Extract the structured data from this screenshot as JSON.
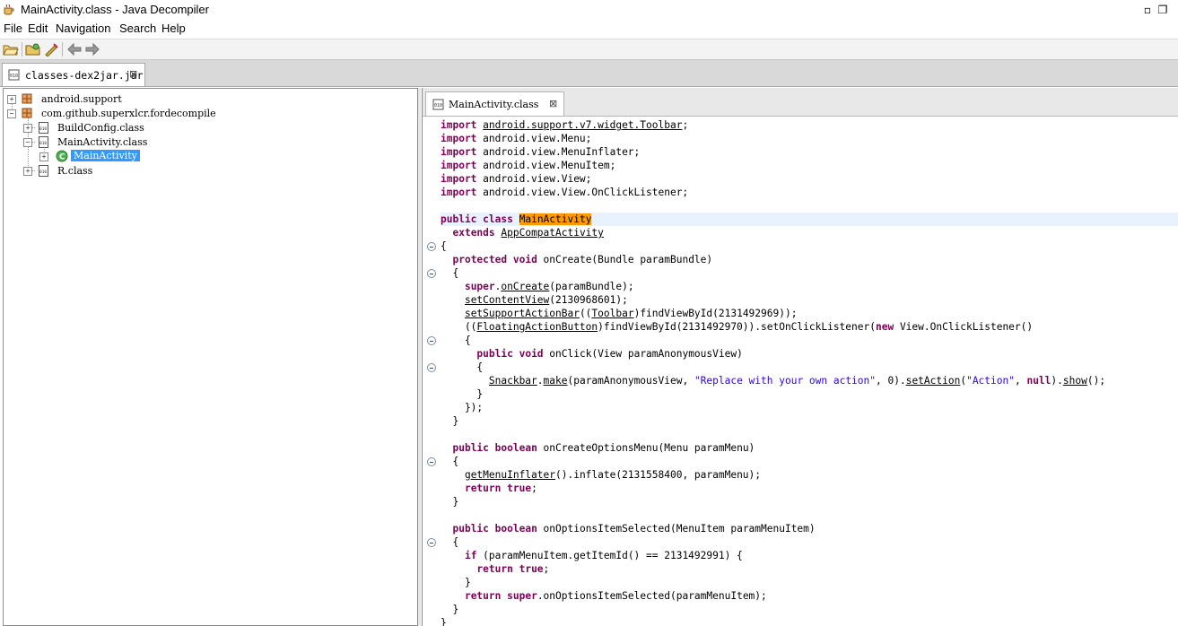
{
  "window": {
    "title": "MainActivity.class - Java Decompiler",
    "maximize_glyph": "▫",
    "restore_glyph": "❐"
  },
  "menu": [
    "File",
    "Edit",
    "Navigation",
    "Search",
    "Help"
  ],
  "toolbar": {
    "icons": [
      "open-file-icon",
      "open-folder-icon",
      "jump-icon",
      "back-icon",
      "forward-icon"
    ]
  },
  "tabs": {
    "outer": {
      "label": "classes-dex2jar.jar",
      "close": "⊠"
    },
    "inner": {
      "label": "MainActivity.class",
      "close": "⊠"
    }
  },
  "tree": [
    {
      "label": "android.support",
      "type": "package",
      "expanded": false,
      "depth": 0
    },
    {
      "label": "com.github.superxlcr.fordecompile",
      "type": "package",
      "expanded": true,
      "depth": 0
    },
    {
      "label": "BuildConfig.class",
      "type": "class-file",
      "expanded": false,
      "depth": 1
    },
    {
      "label": "MainActivity.class",
      "type": "class-file",
      "expanded": true,
      "depth": 1
    },
    {
      "label": "MainActivity",
      "type": "class",
      "expanded": false,
      "depth": 2,
      "selected": true
    },
    {
      "label": "R.class",
      "type": "class-file",
      "expanded": false,
      "depth": 1
    }
  ],
  "code": [
    "import @@android.support.v7.widget.Toolbar@@;",
    "import android.view.Menu;",
    "import android.view.MenuInflater;",
    "import android.view.MenuItem;",
    "import android.view.View;",
    "import android.view.View.OnClickListener;",
    "",
    "public class ##MainActivity##",
    "  extends @@AppCompatActivity@@",
    "{",
    "  protected void onCreate(Bundle paramBundle)",
    "  {",
    "    super.@@onCreate@@(paramBundle);",
    "    @@setContentView@@(2130968601);",
    "    @@setSupportActionBar@@((@@Toolbar@@)findViewById(2131492969));",
    "    ((@@FloatingActionButton@@)findViewById(2131492970)).setOnClickListener(new View.OnClickListener()",
    "    {",
    "      public void onClick(View paramAnonymousView)",
    "      {",
    "        @@Snackbar@@.@@make@@(paramAnonymousView, \"Replace with your own action\", 0).@@setAction@@(\"Action\", null).@@show@@();",
    "      }",
    "    });",
    "  }",
    "",
    "  public boolean onCreateOptionsMenu(Menu paramMenu)",
    "  {",
    "    @@getMenuInflater@@().inflate(2131558400, paramMenu);",
    "    return true;",
    "  }",
    "",
    "  public boolean onOptionsItemSelected(MenuItem paramMenuItem)",
    "  {",
    "    if (paramMenuItem.getItemId() == 2131492991) {",
    "      return true;",
    "    }",
    "    return super.onOptionsItemSelected(paramMenuItem);",
    "  }",
    "}"
  ],
  "highlighted_line_index": 7,
  "fold_marker_lines": [
    9,
    11,
    16,
    18,
    25,
    31
  ],
  "keywords": [
    "import",
    "public",
    "class",
    "extends",
    "protected",
    "void",
    "super",
    "new",
    "boolean",
    "return",
    "true",
    "null",
    "if"
  ],
  "colors": {
    "keyword": "#7f0055",
    "string": "#2a00ff",
    "selection": "#3399ff",
    "class_highlight": "#ff9900",
    "line_highlight": "#e8f2fe"
  }
}
